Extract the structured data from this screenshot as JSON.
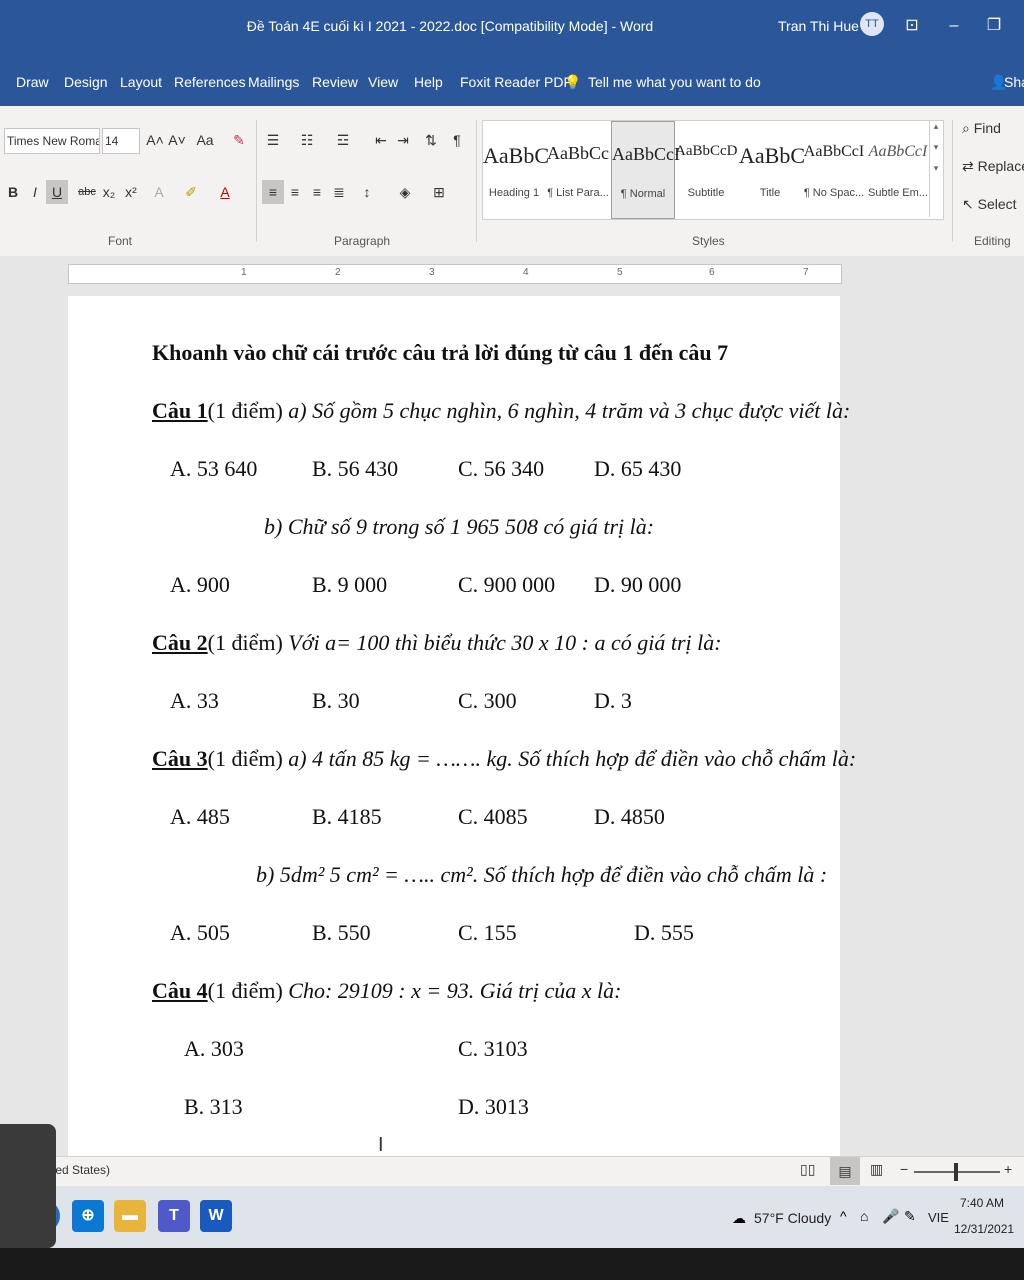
{
  "titlebar": {
    "title": "Đề Toán 4E cuối kì I 2021 - 2022.doc [Compatibility Mode] - Word",
    "user": "Tran Thi Hue GV",
    "avatar_initials": "TT"
  },
  "menu": [
    "Draw",
    "Design",
    "Layout",
    "References",
    "Mailings",
    "Review",
    "View",
    "Help",
    "Foxit Reader PDF"
  ],
  "tell_me": "Tell me what you want to do",
  "share_label": "Share",
  "ribbon": {
    "font_name": "Times New Roma",
    "font_size": "14",
    "groups": {
      "font": "Font",
      "paragraph": "Paragraph",
      "styles": "Styles",
      "editing": "Editing"
    },
    "styles": [
      {
        "sample": "AaBbC",
        "name": "Heading 1"
      },
      {
        "sample": "AaBbCc",
        "name": "¶ List Para..."
      },
      {
        "sample": "AaBbCcI",
        "name": "¶ Normal"
      },
      {
        "sample": "AaBbCcD",
        "name": "Subtitle"
      },
      {
        "sample": "AaBbC",
        "name": "Title"
      },
      {
        "sample": "AaBbCcI",
        "name": "¶ No Spac..."
      },
      {
        "sample": "AaBbCcI",
        "name": "Subtle Em..."
      }
    ],
    "editing": {
      "find": "Find",
      "replace": "Replace",
      "select": "Select"
    }
  },
  "ruler_marks": [
    "1",
    "2",
    "3",
    "4",
    "5",
    "6",
    "7"
  ],
  "document": {
    "heading": "Khoanh vào chữ cái trước câu trả lời đúng từ câu 1 đến câu 7",
    "q1": {
      "label": "Câu 1",
      "points": "(1 điểm)",
      "a_text": "a) Số gồm 5 chục nghìn, 6 nghìn, 4 trăm và 3 chục được viết là:",
      "a_options": [
        "A. 53 640",
        "B. 56 430",
        "C. 56 340",
        "D. 65 430"
      ],
      "b_text": "b) Chữ số 9 trong số 1 965 508  có giá trị là:",
      "b_options": [
        "A. 900",
        "B. 9 000",
        "C. 900 000",
        "D. 90 000"
      ]
    },
    "q2": {
      "label": "Câu 2",
      "points": "(1 điểm)",
      "text": "Với a= 100 thì biểu thức 30 x 10 : a có giá trị  là:",
      "options": [
        "A. 33",
        "B. 30",
        "C. 300",
        "D. 3"
      ]
    },
    "q3": {
      "label": "Câu 3",
      "points": "(1 điểm)",
      "a_text": "a) 4 tấn 85 kg = ……. kg. Số thích hợp để điền vào chỗ chấm là:",
      "a_options": [
        "A. 485",
        "B. 4185",
        "C. 4085",
        "D. 4850"
      ],
      "b_text": "b) 5dm² 5 cm² = ….. cm². Số thích hợp để điền vào chỗ chấm là :",
      "b_options": [
        "A. 505",
        "B. 550",
        "C. 155",
        "D. 555"
      ]
    },
    "q4": {
      "label": "Câu 4",
      "points": "(1 điểm)",
      "text": "Cho:    29109 : x = 93. Giá trị của x là:",
      "options": [
        "A. 303",
        "C. 3103",
        "B.  313",
        "D. 3013"
      ]
    }
  },
  "statusbar": {
    "language": "glish (United States)"
  },
  "taskbar": {
    "weather": "57°F  Cloudy",
    "lang": "VIE",
    "time": "7:40 AM",
    "date": "12/31/2021"
  }
}
